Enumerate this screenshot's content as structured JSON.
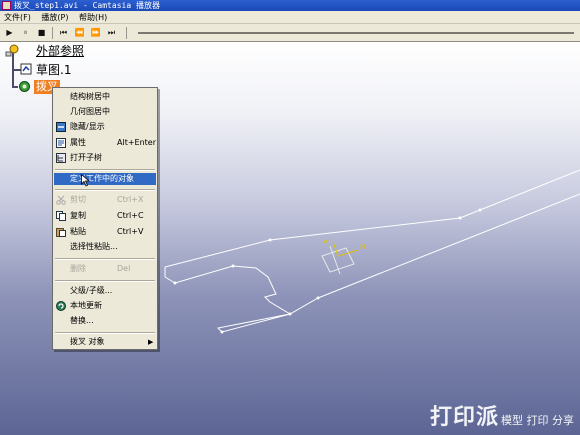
{
  "window": {
    "title": "拨叉_step1.avi - Camtasia 播放器"
  },
  "menubar": {
    "items": [
      "文件(F)",
      "播放(P)",
      "帮助(H)"
    ]
  },
  "toolbar": {
    "buttons": [
      "▶",
      "⏸",
      "■",
      "⏮",
      "⏪",
      "⏩",
      "⏭"
    ]
  },
  "tree": {
    "root_label": "外部参照",
    "child_label": "草图.1",
    "selected_label": "拨叉"
  },
  "context_menu": {
    "items": [
      {
        "label": "结构树居中",
        "shortcut": "",
        "state": "normal",
        "icon": ""
      },
      {
        "label": "几何图居中",
        "shortcut": "",
        "state": "normal",
        "icon": ""
      },
      {
        "label": "隐藏/显示",
        "shortcut": "",
        "state": "normal",
        "icon": "hide-show-icon"
      },
      {
        "label": "属性",
        "shortcut": "Alt+Enter",
        "state": "normal",
        "icon": "properties-icon"
      },
      {
        "label": "打开子树",
        "shortcut": "",
        "state": "normal",
        "icon": "open-subtree-icon"
      },
      {
        "label": "定义工作中的对象",
        "shortcut": "",
        "state": "highlighted",
        "icon": ""
      },
      {
        "label": "剪切",
        "shortcut": "Ctrl+X",
        "state": "disabled",
        "icon": "cut-icon"
      },
      {
        "label": "复制",
        "shortcut": "Ctrl+C",
        "state": "normal",
        "icon": "copy-icon"
      },
      {
        "label": "粘贴",
        "shortcut": "Ctrl+V",
        "state": "normal",
        "icon": "paste-icon"
      },
      {
        "label": "选择性粘贴...",
        "shortcut": "",
        "state": "normal",
        "icon": ""
      },
      {
        "label": "删除",
        "shortcut": "Del",
        "state": "disabled",
        "icon": ""
      },
      {
        "label": "父级/子级...",
        "shortcut": "",
        "state": "normal",
        "icon": ""
      },
      {
        "label": "本地更新",
        "shortcut": "",
        "state": "normal",
        "icon": "local-update-icon"
      },
      {
        "label": "替换...",
        "shortcut": "",
        "state": "normal",
        "icon": ""
      },
      {
        "label": "拨叉 对象",
        "shortcut": "",
        "state": "normal",
        "icon": "",
        "submenu": true
      }
    ]
  },
  "sketch": {
    "axis_v_label": "V",
    "axis_h_label": "H"
  },
  "watermark": {
    "brand": "打印派",
    "text": "模型 打印 分享"
  },
  "colors": {
    "title_bar": "#1a48b8",
    "menu_bg": "#ece9d8",
    "highlight": "#316ac5",
    "selected_node": "#f07f22",
    "sketch_axis": "#e0c000"
  }
}
